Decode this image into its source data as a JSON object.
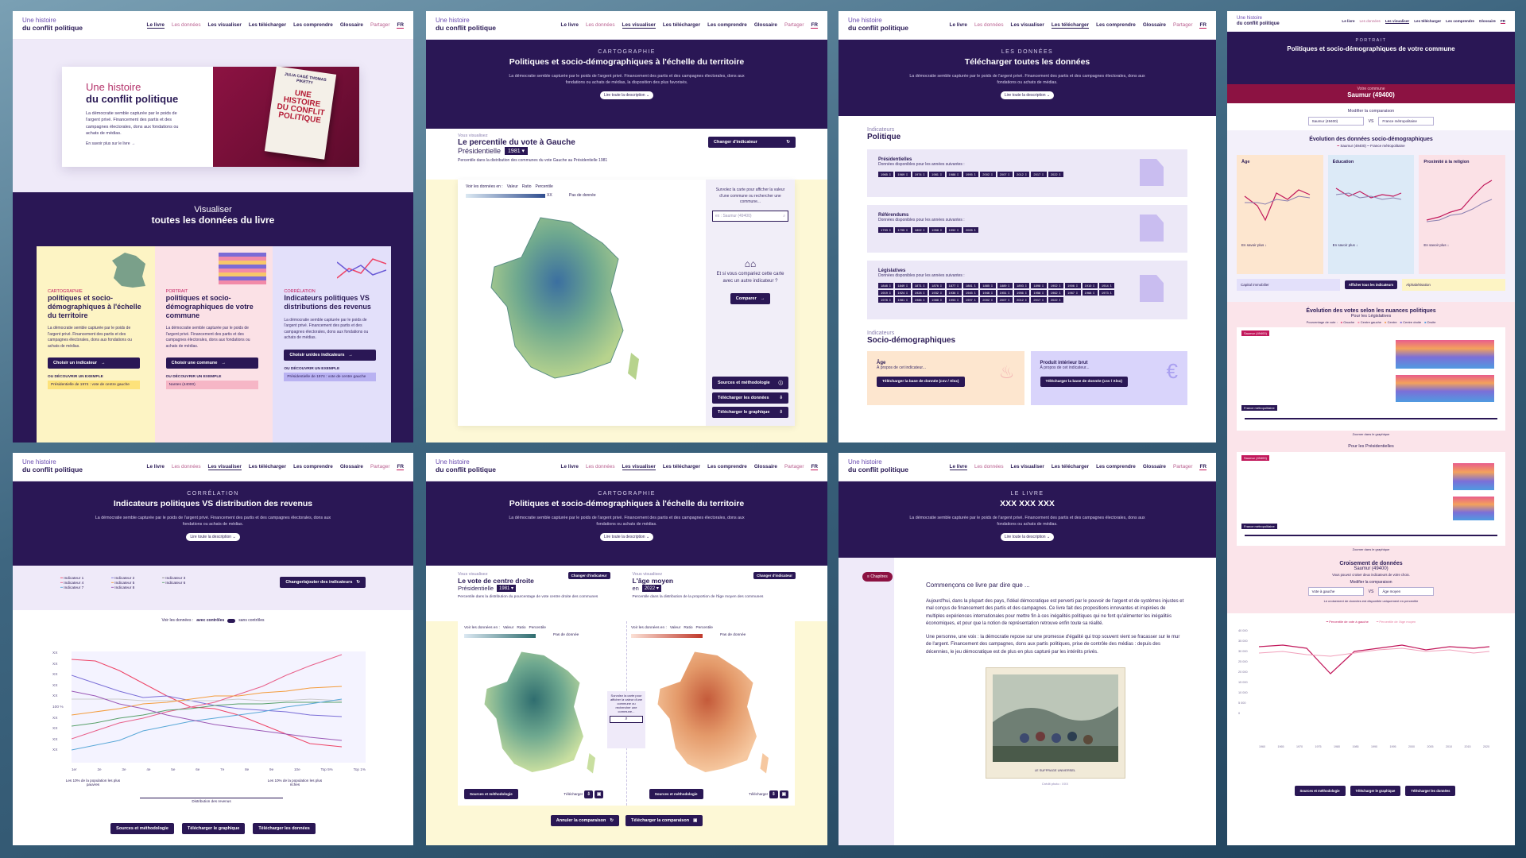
{
  "nav": {
    "logo_line1": "Une histoire",
    "logo_line2": "du conflit politique",
    "links": [
      "Le livre",
      "Les données",
      "Les visualiser",
      "Les télécharger",
      "Les comprendre",
      "Glossaire",
      "Partager"
    ],
    "lang": "FR"
  },
  "p1": {
    "hero_kicker": "Une histoire",
    "hero_title": "du conflit politique",
    "hero_desc": "La démocratie semble capturée par le poids de l'argent privé. Financement des partis et des campagnes électorales, dons aux fondations ou achats de médias.",
    "hero_link": "En savoir plus sur le livre →",
    "book_authors": "JULIA CAGÉ THOMAS PIKETTY",
    "book_title": "UNE HISTOIRE DU CONFLIT POLITIQUE",
    "viz_kicker": "Visualiser",
    "viz_title": "toutes les données du livre",
    "cards": [
      {
        "kicker": "CARTOGRAPHIE",
        "title": "politiques et socio-démographiques à l'échelle du territoire",
        "desc": "La démocratie semble capturée par le poids de l'argent privé. Financement des partis et des campagnes électorales, dons aux fondations ou achats de médias.",
        "btn": "Choisir un indicateur",
        "ex_label": "OU DÉCOUVRIR UN EXEMPLE",
        "ex": "Présidentielle de 1974 : vote de centre gauche"
      },
      {
        "kicker": "PORTRAIT",
        "title": "politiques et socio-démographiques de votre commune",
        "desc": "La démocratie semble capturée par le poids de l'argent privé. Financement des partis et des campagnes électorales, dons aux fondations ou achats de médias.",
        "btn": "Choisir une commune",
        "ex_label": "OU DÉCOUVRIR UN EXEMPLE",
        "ex": "Nantes (44000)"
      },
      {
        "kicker": "CORRÉLATION",
        "title": "Indicateurs politiques VS distributions des revenus",
        "desc": "La démocratie semble capturée par le poids de l'argent privé. Financement des partis et des campagnes électorales, dons aux fondations ou achats de médias.",
        "btn": "Choisir un/des indicateurs",
        "ex_label": "OU DÉCOUVRIR UN EXEMPLE",
        "ex": "Présidentielle de 1974 : vote de centre gauche"
      }
    ]
  },
  "p2": {
    "kicker": "CARTOGRAPHIE",
    "title": "Politiques et socio-démographiques à l'échelle du territoire",
    "desc": "La démocratie semble capturée par le poids de l'argent privé. Financement des partis et des campagnes électorales, dons aux fondations ou achats de médias, la disposition des plus favorisés.",
    "pill": "Lire toute la description ⌄",
    "vous": "Vous visualisez",
    "ind_title": "Le percentile du vote à Gauche",
    "ind_sub": "Présidentielle",
    "year": "1981",
    "change": "Changer d'indicateur",
    "note": "Percentile dans la distribution des communes du vote Gauche au Présidentielle 1981",
    "view_label": "Voir les données en :",
    "opts": [
      "Valeur",
      "Ratio",
      "Percentile"
    ],
    "legend_xx": "XX",
    "nodata": "Pas de donnée",
    "side_hint": "Survolez la carte pour afficher la valeur d'une commune ou rechercher une commune...",
    "search_ph": "ex : Saumur (49400)",
    "compare_q": "Et si vous compariez cette carte avec un autre indicateur ?",
    "compare_btn": "Comparer",
    "src": "Sources et méthodologie",
    "dl_data": "Télécharger les données",
    "dl_graph": "Télécharger le graphique"
  },
  "p3": {
    "kicker": "LES DONNÉES",
    "title": "Télécharger toutes les données",
    "desc": "La démocratie semble capturée par le poids de l'argent privé. Financement des partis et des campagnes électorales, dons aux fondations ou achats de médias.",
    "pill": "Lire toute la description ⌄",
    "sec1_k": "Indicateurs",
    "sec1": "Politique",
    "sec2_k": "Indicateurs",
    "sec2": "Socio-démographiques",
    "avail": "Données disponibles pour les années suivantes :",
    "pres_title": "Présidentielles",
    "pres_years": [
      "1965",
      "1969",
      "1974",
      "1981",
      "1988",
      "1995",
      "2002",
      "2007",
      "2012",
      "2017",
      "2022"
    ],
    "ref_title": "Référendums",
    "ref_years": [
      "1793",
      "1795",
      "1802",
      "1958",
      "1992",
      "2005"
    ],
    "leg_title": "Législatives",
    "leg_years": [
      "1848",
      "1849",
      "1871",
      "1876",
      "1877",
      "1881",
      "1885",
      "1889",
      "1893",
      "1898",
      "1902",
      "1906",
      "1910",
      "1914",
      "1919",
      "1924",
      "1928",
      "1932",
      "1936",
      "1945",
      "1946",
      "1951",
      "1956",
      "1958",
      "1962",
      "1967",
      "1968",
      "1973",
      "1978",
      "1981",
      "1986",
      "1988",
      "1993",
      "1997",
      "2002",
      "2007",
      "2012",
      "2017",
      "2022"
    ],
    "age_title": "Âge",
    "age_sub": "À propos de cet indicateur...",
    "age_btn": "Télécharger la base de donnée (csv / Xlsx)",
    "pib_title": "Produit intérieur brut",
    "pib_sub": "À propos de cet indicateur...",
    "pib_btn": "Télécharger la base de donnée (csv / Xlsx)"
  },
  "p4": {
    "kicker": "PORTRAIT",
    "title": "Politiques et socio-démographiques de votre commune",
    "commune_label": "Votre commune",
    "commune": "Saumur (49400)",
    "modify": "Modifier la comparaison",
    "sel_a": "Saumur (49400)",
    "sel_b": "France métropolitaine",
    "vs": "VS",
    "evo_title": "Évolution des données socio-démographiques",
    "legend": [
      "Saumur (49400)",
      "France métropolitaine"
    ],
    "mini": [
      "Âge",
      "Éducation",
      "Proximité à la religion"
    ],
    "mini_more": "En savoir plus ↓",
    "capital": "Capital immobilier",
    "afficher": "Afficher tous les indicateurs",
    "alpha": "Alphabétisation",
    "votes_title": "Évolution des votes selon les nuances politiques",
    "votes_sub": "Pour les Législatives",
    "votes_view": "Pourcentage de vote :",
    "parties": [
      "Gauche",
      "Centre gauche",
      "Centre",
      "Centre droite",
      "Droite"
    ],
    "saumur_tag": "Saumur (49400)",
    "france_tag": "France métropolitaine",
    "zoom_note": "Zoomer dans le graphique",
    "pres_sub": "Pour les Présidentielles",
    "cross_title": "Croisement de données",
    "cross_sub": "Saumur (49400)",
    "cross_desc": "Vous pouvez croiser deux indicateurs de votre choix.",
    "cross_modify": "Modifier la comparaison",
    "cross_a": "Vote à gauche",
    "cross_b": "Âge moyen",
    "cross_note": "Le croisement de données est disponible uniquement en percentile",
    "cross_legend": [
      "Percentile de vote à gauche",
      "Percentile de l'âge moyen"
    ],
    "y_ticks": [
      "40 000",
      "35 000",
      "30 000",
      "25 000",
      "20 000",
      "15 000",
      "10 000",
      "5 000",
      "0"
    ],
    "x_ticks": [
      "1960",
      "1965",
      "1970",
      "1975",
      "1980",
      "1985",
      "1990",
      "1995",
      "2000",
      "2005",
      "2010",
      "2015",
      "2020"
    ],
    "btns": [
      "Sources et méthodologie",
      "Télécharger le graphique",
      "Télécharger les données"
    ]
  },
  "p5": {
    "kicker": "CORRÉLATION",
    "title": "Indicateurs politiques VS distribution des revenus",
    "desc": "La démocratie semble capturée par le poids de l'argent privé. Financement des partis et des campagnes électorales, dons aux fondations ou achats de médias.",
    "pill": "Lire toute la description ⌄",
    "legend": [
      "Indicateur 1",
      "Indicateur 2",
      "Indicateur 3",
      "Indicateur 4",
      "Indicateur 5",
      "Indicateur 6",
      "Indicateur 7",
      "Indicateur 8"
    ],
    "change": "Changer/ajouter des indicateurs",
    "view": "Voir les données :",
    "with": "avec contrôles",
    "without": "sans contrôles",
    "y_ticks": [
      "XX",
      "XX",
      "XX",
      "XX",
      "XX",
      "100 %",
      "XX",
      "XX",
      "XX",
      "XX"
    ],
    "x_ticks": [
      "1er",
      "2e",
      "3e",
      "4e",
      "5e",
      "6e",
      "7e",
      "8e",
      "9e",
      "10e",
      "Top 5%",
      "Top 1%"
    ],
    "low": "Les 10% de la population les plus pauvres",
    "high": "Les 10% de la population les plus riches",
    "axis": "Distribution des revenus",
    "btns": [
      "Sources et méthodologie",
      "Télécharger le graphique",
      "Télécharger les données"
    ]
  },
  "p6": {
    "kicker": "CARTOGRAPHIE",
    "title": "Politiques et socio-démographiques à l'échelle du territoire",
    "desc": "La démocratie semble capturée par le poids de l'argent privé. Financement des partis et des campagnes électorales, dons aux fondations ou achats de médias.",
    "pill": "Lire toute la description ⌄",
    "left_vous": "Vous visualisez",
    "left_title": "Le vote de centre droite",
    "left_sub": "Présidentielle",
    "left_year": "1981",
    "left_note": "Percentile dans la distribution du pourcentage de vote centre droite des communes",
    "right_vous": "Vous visualisez",
    "right_title": "L'âge moyen",
    "right_en": "en",
    "right_year": "2022",
    "right_note": "Percentile dans la distribution de la proportion de l'âge moyen des communes",
    "change": "Changer d'indicateur",
    "view": "Voir les données en :",
    "opts": [
      "Valeur",
      "Ratio",
      "Percentile"
    ],
    "nodata": "Pas de donnée",
    "hint": "Survolez la carte pour afficher la valeur d'une commune ou rechercher une commune...",
    "src": "Sources et méthodologie",
    "dl": "Télécharger",
    "cancel": "Annuler la comparaison",
    "dl_cmp": "Télécharger la comparaison"
  },
  "p7": {
    "kicker": "LE LIVRE",
    "title": "XXX XXX XXX",
    "desc": "La démocratie semble capturée par le poids de l'argent privé. Financement des partis et des campagnes électorales, dons aux fondations ou achats de médias.",
    "pill": "Lire toute la description ⌄",
    "chapters": "Chapitres",
    "intro": "Commençons ce livre par dire que ...",
    "p1": "Aujourd'hui, dans la plupart des pays, l'idéal démocratique est perverti par le pouvoir de l'argent et de systèmes injustes et mal conçus de financement des partis et des campagnes. Ce livre fait des propositions innovantes et inspirées de multiples expériences internationales pour mettre fin à ces inégalités politiques qui ne font qu'alimenter les inégalités économiques, et pour que la notion de représentation retrouve enfin toute sa réalité.",
    "p2": "Une personne, une voix : la démocratie repose sur une promesse d'égalité qui trop souvent vient se fracasser sur le mur de l'argent. Financement des campagnes, dons aux partis politiques, prise de contrôle des médias : depuis des décennies, le jeu démocratique est de plus en plus capturé par les intérêts privés.",
    "caption": "LE SUFFRAGE UNIVERSEL",
    "credit": "Crédit photo : XXX"
  }
}
